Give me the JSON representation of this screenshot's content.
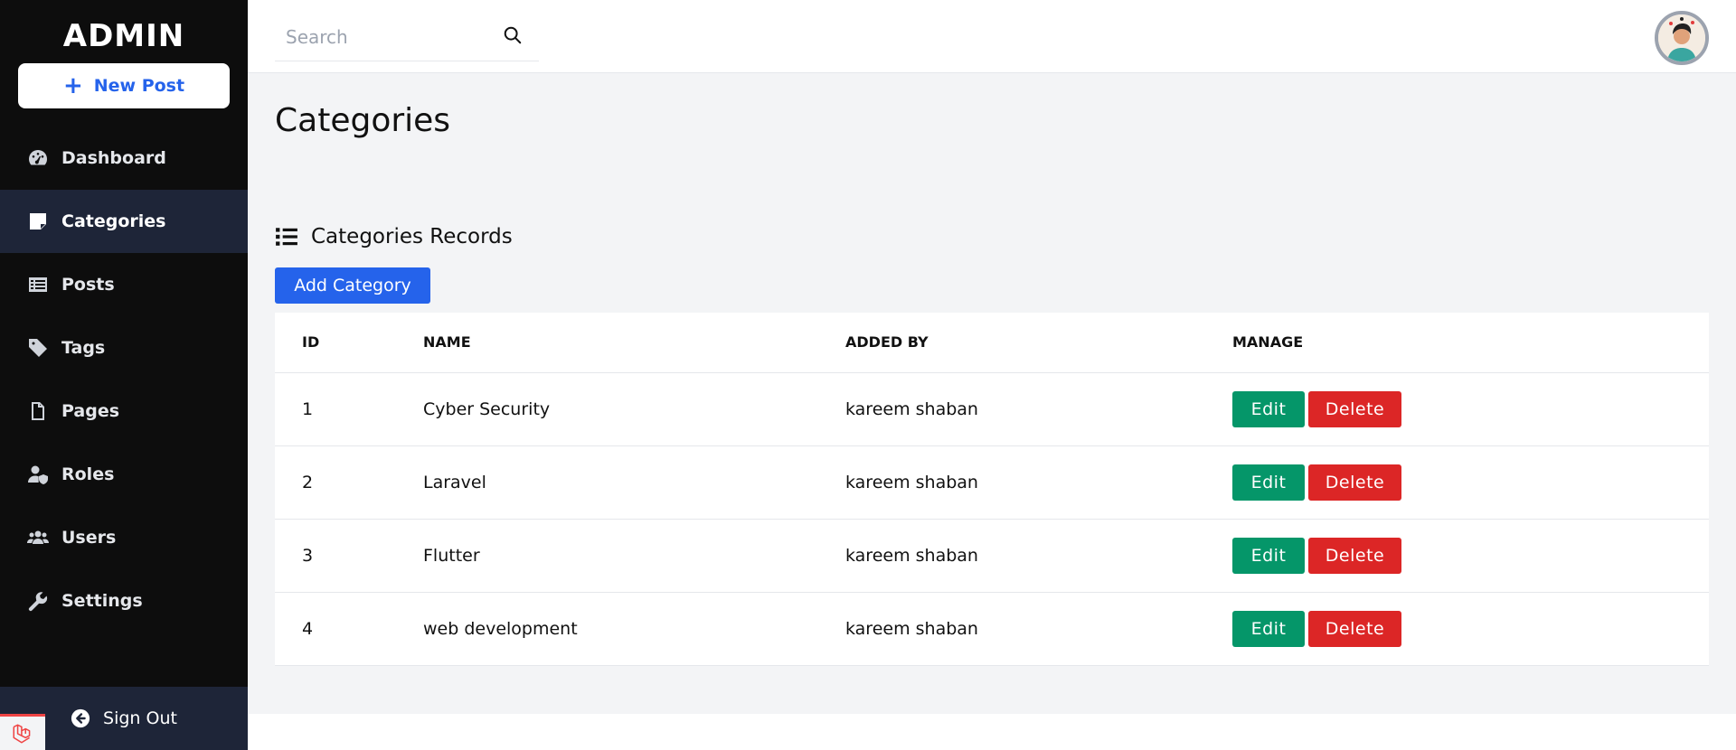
{
  "sidebar": {
    "brand": "ADMIN",
    "new_post_label": "New Post",
    "items": [
      {
        "label": "Dashboard",
        "icon": "gauge-icon"
      },
      {
        "label": "Categories",
        "icon": "note-icon",
        "active": true
      },
      {
        "label": "Posts",
        "icon": "list-alt-icon"
      },
      {
        "label": "Tags",
        "icon": "tag-icon"
      },
      {
        "label": "Pages",
        "icon": "file-icon"
      },
      {
        "label": "Roles",
        "icon": "user-shield-icon"
      },
      {
        "label": "Users",
        "icon": "users-icon"
      },
      {
        "label": "Settings",
        "icon": "wrench-icon"
      }
    ],
    "signout_label": "Sign Out"
  },
  "topbar": {
    "search_placeholder": "Search"
  },
  "main": {
    "title": "Categories",
    "records_heading": "Categories Records",
    "add_button": "Add Category",
    "table": {
      "headers": [
        "ID",
        "NAME",
        "ADDED BY",
        "MANAGE"
      ],
      "rows": [
        {
          "id": "1",
          "name": "Cyber Security",
          "added_by": "kareem shaban"
        },
        {
          "id": "2",
          "name": "Laravel",
          "added_by": "kareem shaban"
        },
        {
          "id": "3",
          "name": "Flutter",
          "added_by": "kareem shaban"
        },
        {
          "id": "4",
          "name": "web development",
          "added_by": "kareem shaban"
        }
      ],
      "edit_label": "Edit",
      "delete_label": "Delete"
    }
  },
  "colors": {
    "sidebar_bg": "#0d0d0d",
    "active_item_bg": "#1e2538",
    "primary": "#2563eb",
    "edit": "#059669",
    "delete": "#dc2626",
    "content_bg": "#f3f4f6"
  }
}
